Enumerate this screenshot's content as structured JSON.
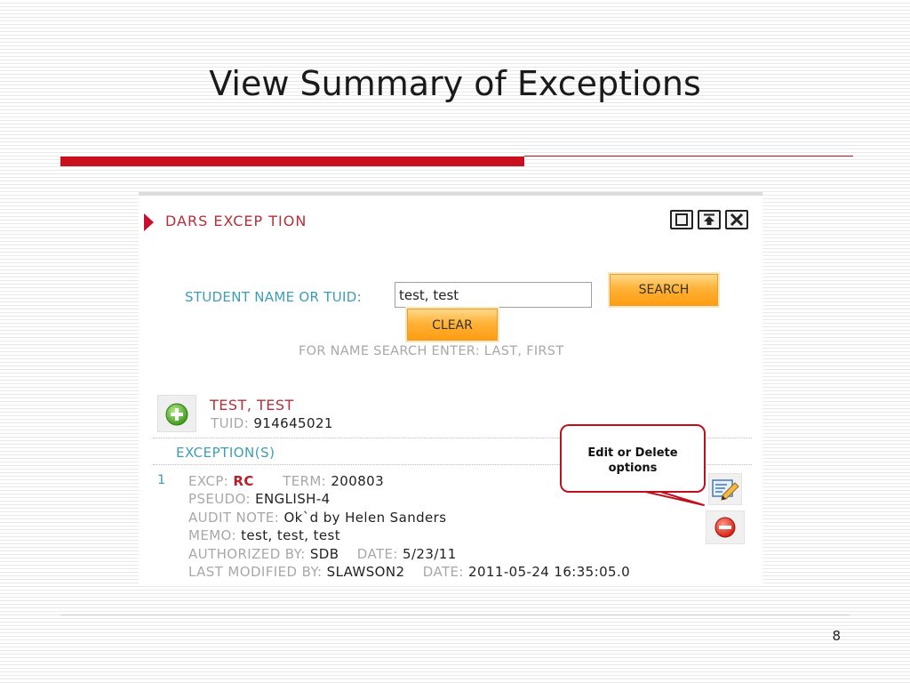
{
  "slide": {
    "title": "View Summary of Exceptions",
    "page_number": "8"
  },
  "colors": {
    "accent_red": "#c8101e",
    "label_teal": "#3d9db5",
    "name_red": "#b3303a",
    "button_orange": "#ff9c12"
  },
  "panel": {
    "title": "DARS EXCEP TION",
    "window_controls": [
      "maximize-icon",
      "minimize-icon",
      "close-icon"
    ]
  },
  "search": {
    "label": "STUDENT NAME OR TUID:",
    "value": "test, test",
    "search_button": "SEARCH",
    "clear_button": "CLEAR",
    "hint": "FOR NAME SEARCH ENTER: LAST, FIRST"
  },
  "student": {
    "name": "TEST, TEST",
    "tuid_label": "TUID:",
    "tuid": "914645021"
  },
  "exceptions": {
    "heading": "EXCEPTION(S)",
    "items": [
      {
        "index": "1",
        "excp_label": "EXCP:",
        "excp": "RC",
        "term_label": "TERM:",
        "term": "200803",
        "pseudo_label": "PSEUDO:",
        "pseudo": "ENGLISH-4",
        "audit_note_label": "AUDIT NOTE:",
        "audit_note": "Ok`d by Helen Sanders",
        "memo_label": "MEMO:",
        "memo": "test, test, test",
        "authorized_label": "AUTHORIZED BY:",
        "authorized_by": "SDB",
        "date_label": "DATE:",
        "authorized_date": "5/23/11",
        "last_modified_label": "LAST MODIFIED BY:",
        "last_modified_by": "SLAWSON2",
        "last_modified_date": "2011-05-24 16:35:05.0"
      }
    ]
  },
  "callout": {
    "line1": "Edit or Delete",
    "line2": "options"
  }
}
